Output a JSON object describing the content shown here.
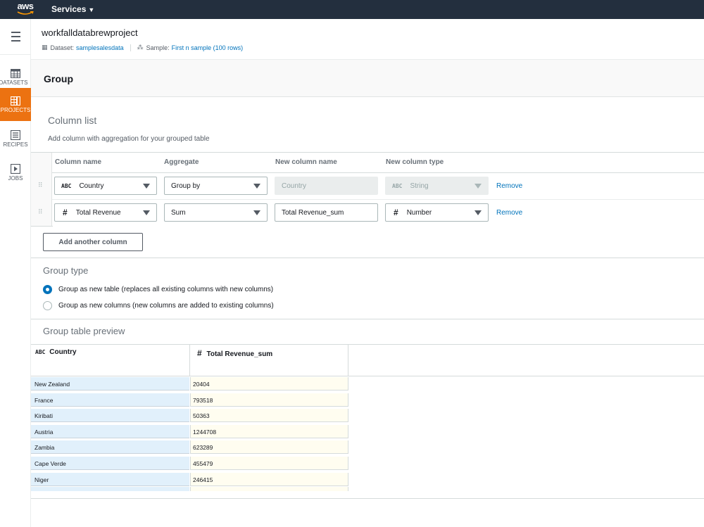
{
  "topbar": {
    "logo": "aws",
    "services_label": "Services"
  },
  "sidenav": {
    "items": [
      {
        "label": "Datasets",
        "icon": "table-icon",
        "active": false
      },
      {
        "label": "Projects",
        "icon": "project-grid-icon",
        "active": true
      },
      {
        "label": "Recipes",
        "icon": "recipe-list-icon",
        "active": false
      },
      {
        "label": "Jobs",
        "icon": "play-icon",
        "active": false
      }
    ]
  },
  "header": {
    "project_name": "workfalldatabrewproject",
    "dataset_label": "Dataset:",
    "dataset_value": "samplesalesdata",
    "sample_label": "Sample:",
    "sample_value": "First n sample (100 rows)"
  },
  "panel": {
    "title": "Group",
    "column_list": {
      "title": "Column list",
      "description": "Add column with aggregation for your grouped table",
      "headers": {
        "column_name": "Column name",
        "aggregate": "Aggregate",
        "new_column_name": "New column name",
        "new_column_type": "New column type"
      },
      "rows": [
        {
          "column_type_badge": "ABC",
          "column_name": "Country",
          "aggregate": "Group by",
          "new_column_name": "Country",
          "new_type_badge": "ABC",
          "new_column_type": "String",
          "remove_label": "Remove",
          "disabled": true
        },
        {
          "column_type_badge": "#",
          "column_name": "Total Revenue",
          "aggregate": "Sum",
          "new_column_name": "Total Revenue_sum",
          "new_type_badge": "#",
          "new_column_type": "Number",
          "remove_label": "Remove",
          "disabled": false
        }
      ],
      "add_button": "Add another column"
    },
    "group_type": {
      "title": "Group type",
      "options": [
        {
          "label": "Group as new table (replaces all existing columns with new columns)",
          "selected": true
        },
        {
          "label": "Group as new columns (new columns are added to existing columns)",
          "selected": false
        }
      ]
    },
    "preview": {
      "title": "Group table preview",
      "columns": [
        {
          "type_badge": "ABC",
          "name": "Country"
        },
        {
          "type_badge": "#",
          "name": "Total Revenue_sum"
        }
      ],
      "rows": [
        [
          "New Zealand",
          "20404"
        ],
        [
          "France",
          "793518"
        ],
        [
          "Kiribati",
          "50363"
        ],
        [
          "Austria",
          "1244708"
        ],
        [
          "Zambia",
          "623289"
        ],
        [
          "Cape Verde",
          "455479"
        ],
        [
          "Niger",
          "246415"
        ]
      ]
    }
  }
}
